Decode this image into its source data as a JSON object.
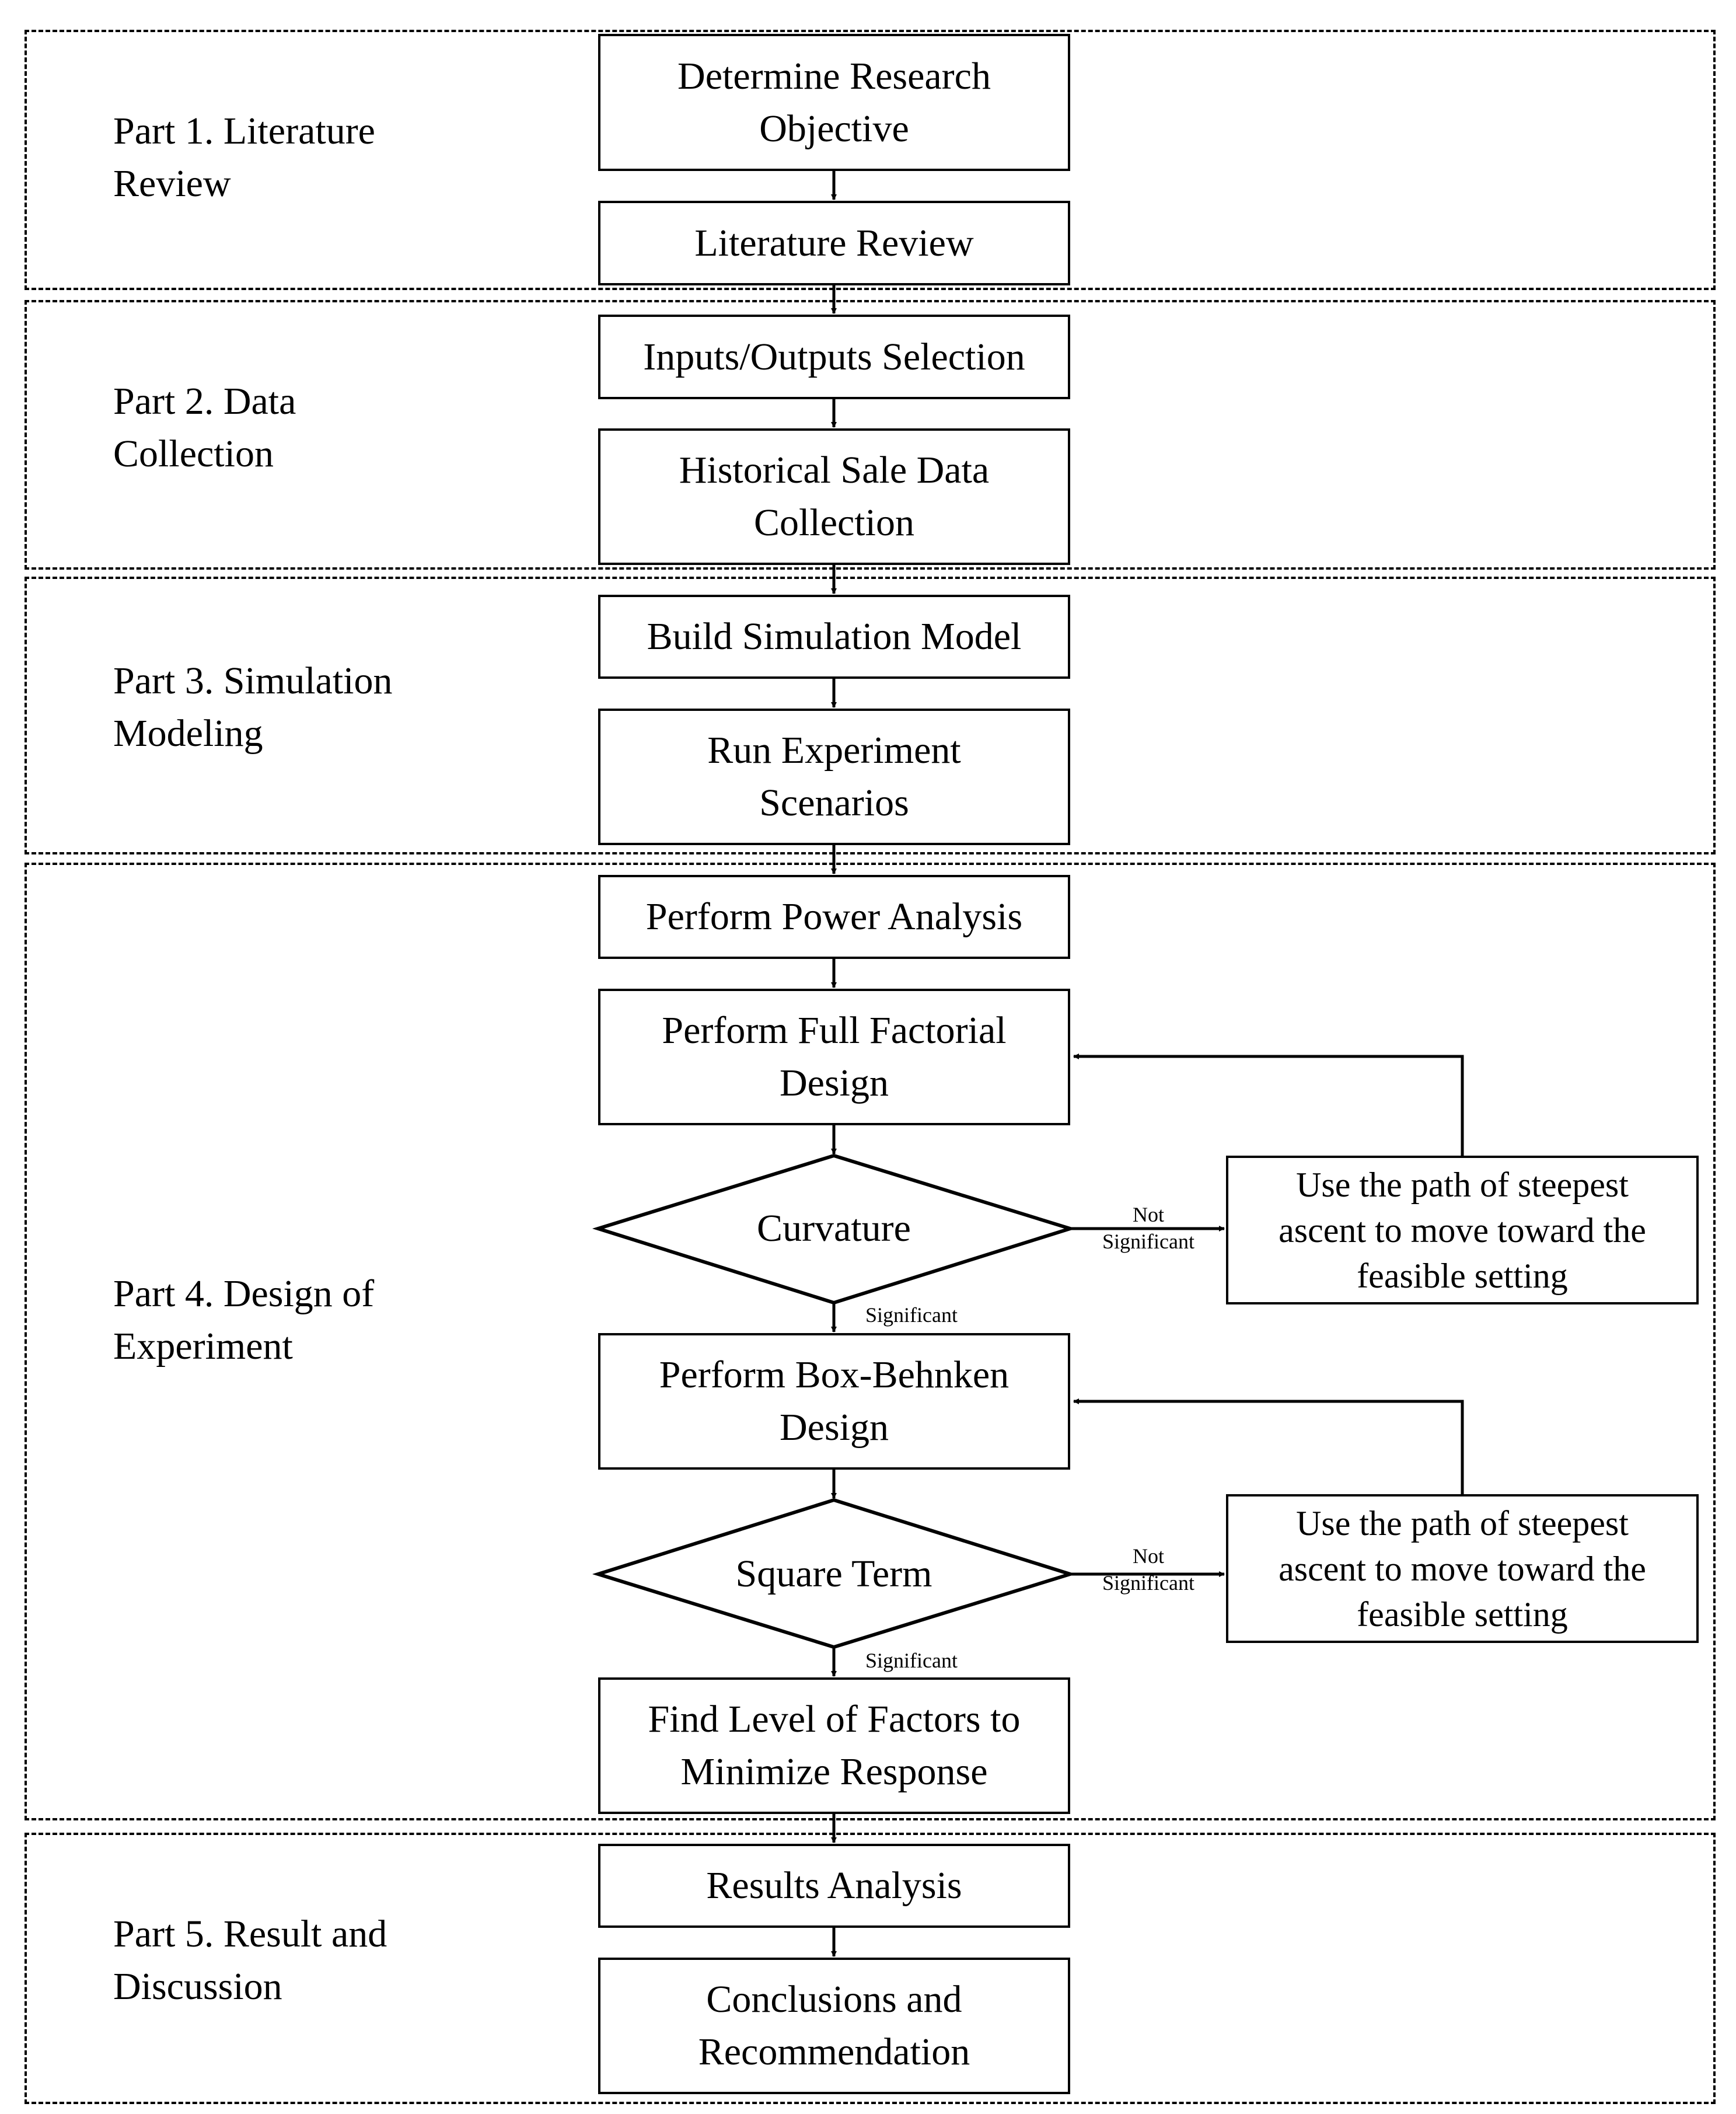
{
  "parts": [
    {
      "label": "Part 1. Literature\nReview"
    },
    {
      "label": "Part 2. Data\nCollection"
    },
    {
      "label": "Part 3. Simulation\nModeling"
    },
    {
      "label": "Part 4. Design of\nExperiment"
    },
    {
      "label": "Part 5. Result and\nDiscussion"
    }
  ],
  "steps": {
    "determine_objective": "Determine Research\nObjective",
    "literature_review": "Literature Review",
    "inputs_outputs": "Inputs/Outputs Selection",
    "historical_data": "Historical Sale Data\nCollection",
    "build_model": "Build Simulation Model",
    "run_scenarios": "Run Experiment\nScenarios",
    "power_analysis": "Perform Power Analysis",
    "full_factorial": "Perform Full Factorial\nDesign",
    "box_behnken": "Perform Box-Behnken\nDesign",
    "find_levels": "Find Level of Factors to\nMinimize Response",
    "results_analysis": "Results Analysis",
    "conclusions": "Conclusions and\nRecommendation"
  },
  "decisions": {
    "curvature": "Curvature",
    "square_term": "Square Term"
  },
  "side_steps": {
    "steepest_ascent_1": "Use the path of steepest\nascent to move toward the\nfeasible setting",
    "steepest_ascent_2": "Use the path of steepest\nascent to move toward the\nfeasible setting"
  },
  "edge_labels": {
    "not_significant": "Not\nSignificant",
    "significant": "Significant"
  }
}
